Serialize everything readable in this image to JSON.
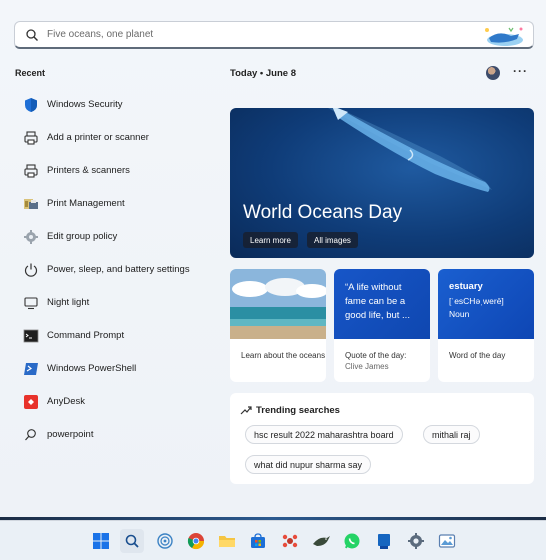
{
  "search": {
    "placeholder": "Five oceans, one planet"
  },
  "recent": {
    "title": "Recent",
    "items": [
      {
        "label": "Windows Security",
        "icon": "shield-icon"
      },
      {
        "label": "Add a printer or scanner",
        "icon": "printer-icon"
      },
      {
        "label": "Printers & scanners",
        "icon": "printer-icon"
      },
      {
        "label": "Print Management",
        "icon": "print-management-icon"
      },
      {
        "label": "Edit group policy",
        "icon": "group-policy-icon"
      },
      {
        "label": "Power, sleep, and battery settings",
        "icon": "power-icon"
      },
      {
        "label": "Night light",
        "icon": "monitor-icon"
      },
      {
        "label": "Command Prompt",
        "icon": "cmd-icon"
      },
      {
        "label": "Windows PowerShell",
        "icon": "powershell-icon"
      },
      {
        "label": "AnyDesk",
        "icon": "anydesk-icon"
      },
      {
        "label": "powerpoint",
        "icon": "search-icon"
      }
    ]
  },
  "header": {
    "today": "Today",
    "date": "June 8",
    "more": "···"
  },
  "hero": {
    "title": "World Oceans Day",
    "learn_more": "Learn more",
    "all_images": "All images"
  },
  "cards": {
    "learn": {
      "caption": "Learn about the oceans"
    },
    "quote": {
      "text": "“A life without fame can be a good life, but ...",
      "caption": "Quote of the day:",
      "author": "Clive James"
    },
    "word": {
      "word": "estuary",
      "phonetic": "[ˈesCHəˌwerē]",
      "pos": "Noun",
      "caption": "Word of the day"
    }
  },
  "trending": {
    "title": "Trending searches",
    "chips": [
      "hsc result 2022 maharashtra board",
      "mithali raj",
      "what did nupur sharma say"
    ]
  },
  "taskbar": {
    "icons": [
      "windows-start-icon",
      "search-icon",
      "copilot-icon",
      "chrome-icon",
      "file-explorer-icon",
      "store-icon",
      "app-icon",
      "bird-icon",
      "whatsapp-icon",
      "blue-app-icon",
      "settings-icon",
      "photos-icon"
    ]
  },
  "colors": {
    "accent": "#1756c8",
    "hero_bg": "#0f3c78"
  }
}
